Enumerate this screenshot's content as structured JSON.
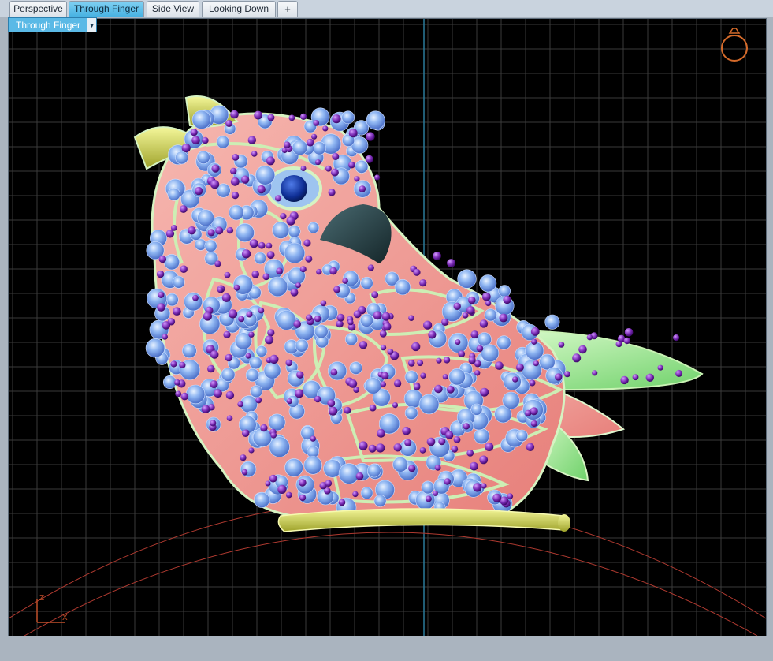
{
  "tabs": [
    {
      "label": "Perspective",
      "active": false
    },
    {
      "label": "Through Finger",
      "active": true
    },
    {
      "label": "Side View",
      "active": false
    },
    {
      "label": "Looking Down",
      "active": false
    }
  ],
  "add_tab_symbol": "+",
  "viewport": {
    "label": "Through Finger",
    "background": "#000000",
    "grid_color": "#3a3a3a",
    "axis_color": "#2a7a9a",
    "axis_labels": {
      "z": "Z",
      "x": "X"
    },
    "axis_icon_color": "#c0502a",
    "ring_icon": "ring-navigation-icon",
    "model": "jeweled-bird-brooch"
  }
}
